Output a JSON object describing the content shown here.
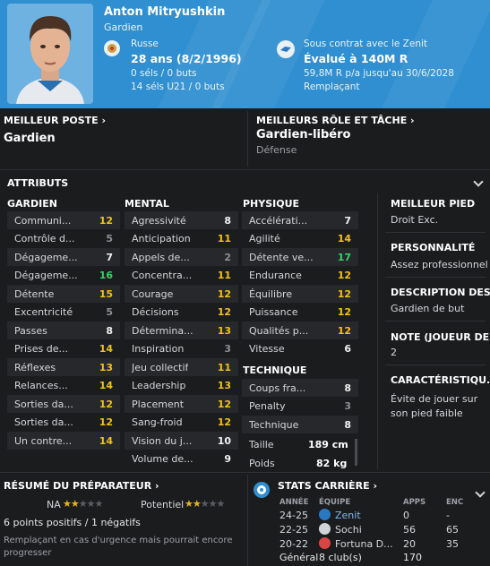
{
  "player": {
    "name": "Anton Mitryushkin",
    "position": "Gardien",
    "nationality": "Russe",
    "age": "28 ans (8/2/1996)",
    "caps": "0 séls / 0 buts",
    "u21": "14 séls U21 / 0 buts",
    "contract": "Sous contrat avec le Zenit",
    "value": "Évalué à 140M R",
    "wage": "59,8M R p/a jusqu'au 30/6/2028",
    "squad_status": "Remplaçant"
  },
  "best_position": {
    "title": "MEILLEUR POSTE",
    "value": "Gardien"
  },
  "best_role": {
    "title": "MEILLEURS RÔLE ET TÂCHE",
    "value": "Gardien-libéro",
    "duty": "Défense"
  },
  "attributes": {
    "title": "ATTRIBUTS",
    "goalkeeping": {
      "title": "GARDIEN",
      "rows": [
        {
          "label": "Communi...",
          "value": "12"
        },
        {
          "label": "Contrôle d...",
          "value": "5"
        },
        {
          "label": "Dégageme...",
          "value": "7"
        },
        {
          "label": "Dégageme...",
          "value": "16"
        },
        {
          "label": "Détente",
          "value": "15"
        },
        {
          "label": "Excentricité",
          "value": "5"
        },
        {
          "label": "Passes",
          "value": "8"
        },
        {
          "label": "Prises de...",
          "value": "14"
        },
        {
          "label": "Réflexes",
          "value": "13"
        },
        {
          "label": "Relances...",
          "value": "14"
        },
        {
          "label": "Sorties da...",
          "value": "12"
        },
        {
          "label": "Sorties da...",
          "value": "12"
        },
        {
          "label": "Un contre...",
          "value": "14"
        }
      ]
    },
    "mental": {
      "title": "MENTAL",
      "rows": [
        {
          "label": "Agressivité",
          "value": "8"
        },
        {
          "label": "Anticipation",
          "value": "11"
        },
        {
          "label": "Appels de...",
          "value": "2"
        },
        {
          "label": "Concentra...",
          "value": "11"
        },
        {
          "label": "Courage",
          "value": "12"
        },
        {
          "label": "Décisions",
          "value": "12"
        },
        {
          "label": "Détermina...",
          "value": "13"
        },
        {
          "label": "Inspiration",
          "value": "3"
        },
        {
          "label": "Jeu collectif",
          "value": "11"
        },
        {
          "label": "Leadership",
          "value": "13"
        },
        {
          "label": "Placement",
          "value": "12"
        },
        {
          "label": "Sang-froid",
          "value": "12"
        },
        {
          "label": "Vision du j...",
          "value": "10"
        },
        {
          "label": "Volume de...",
          "value": "9"
        }
      ]
    },
    "physical": {
      "title": "PHYSIQUE",
      "rows": [
        {
          "label": "Accélérati...",
          "value": "7"
        },
        {
          "label": "Agilité",
          "value": "14"
        },
        {
          "label": "Détente ve...",
          "value": "17"
        },
        {
          "label": "Endurance",
          "value": "12"
        },
        {
          "label": "Équilibre",
          "value": "12"
        },
        {
          "label": "Puissance",
          "value": "12"
        },
        {
          "label": "Qualités p...",
          "value": "12"
        },
        {
          "label": "Vitesse",
          "value": "6"
        }
      ]
    },
    "technical": {
      "title": "TECHNIQUE",
      "rows": [
        {
          "label": "Coups fra...",
          "value": "8"
        },
        {
          "label": "Penalty",
          "value": "3"
        },
        {
          "label": "Technique",
          "value": "8"
        }
      ]
    },
    "height_label": "Taille",
    "height": "189 cm",
    "weight_label": "Poids",
    "weight": "82 kg"
  },
  "side": {
    "foot_title": "MEILLEUR PIED",
    "foot": "Droit Exc.",
    "personality_title": "PERSONNALITÉ",
    "personality": "Assez professionnel",
    "description_title": "DESCRIPTION DES...",
    "description": "Gardien de but",
    "rating_title": "NOTE (JOUEUR DE...",
    "rating": "2",
    "traits_title": "CARACTÉRISTIQU...",
    "traits_1": "Évite de jouer sur",
    "traits_2": "son pied faible"
  },
  "coach_report": {
    "title": "RÉSUMÉ DU PRÉPARATEUR",
    "ability_label": "NA",
    "ability_stars": 2,
    "potential_label": "Potentiel",
    "potential_stars": 2,
    "points": "6 points positifs / 1 négatifs",
    "summary": "Remplaçant en cas d'urgence mais pourrait encore progresser"
  },
  "career": {
    "title": "STATS CARRIÈRE",
    "headers": {
      "season": "ANNÉE",
      "team": "ÉQUIPE",
      "apps": "APPS",
      "conc": "ENC"
    },
    "rows": [
      {
        "season": "24-25",
        "team": "Zenit",
        "apps": "0",
        "conc": "-"
      },
      {
        "season": "22-25",
        "team": "Sochi",
        "apps": "56",
        "conc": "65"
      },
      {
        "season": "20-22",
        "team": "Fortuna D...",
        "apps": "20",
        "conc": "35"
      }
    ],
    "total_label": "Général",
    "total_clubs": "8 club(s)",
    "total_apps": "170"
  },
  "colors": {
    "header": "#2f8fd0",
    "good": "#f2c21b",
    "top": "#39d06a"
  }
}
